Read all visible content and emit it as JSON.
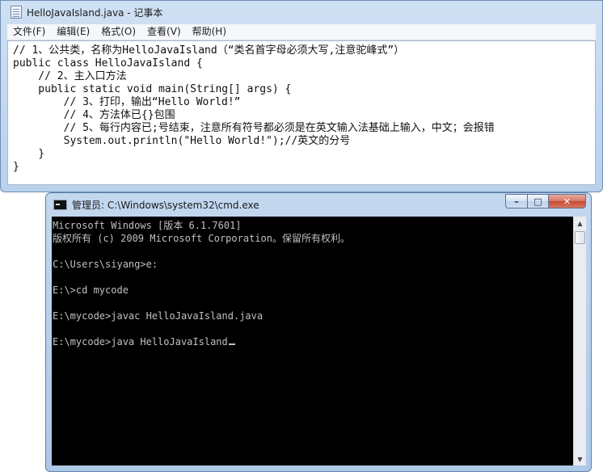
{
  "notepad": {
    "title": "HelloJavaIsland.java - 记事本",
    "menu": [
      {
        "label": "文件(F)"
      },
      {
        "label": "编辑(E)"
      },
      {
        "label": "格式(O)"
      },
      {
        "label": "查看(V)"
      },
      {
        "label": "帮助(H)"
      }
    ],
    "lines": [
      "// 1、公共类，名称为HelloJavaIsland（“类名首字母必须大写,注意驼峰式”）",
      "public class HelloJavaIsland {",
      "    // 2、主入口方法",
      "    public static void main(String[] args) {",
      "        // 3、打印，输出“Hello World!”",
      "        // 4、方法体已{}包围",
      "        // 5、每行内容已;号结束，注意所有符号都必须是在英文输入法基础上输入，中文；会报错",
      "        System.out.println(\"Hello World!\");//英文的分号",
      "    }",
      "}"
    ]
  },
  "cmd": {
    "title": "管理员: C:\\Windows\\system32\\cmd.exe",
    "buttons": {
      "minimize": "–",
      "maximize": "□",
      "close": "✕"
    },
    "lines": [
      "Microsoft Windows [版本 6.1.7601]",
      "版权所有 (c) 2009 Microsoft Corporation。保留所有权利。",
      "",
      "C:\\Users\\siyang>e:",
      "",
      "E:\\>cd mycode",
      "",
      "E:\\mycode>javac HelloJavaIsland.java",
      "",
      "E:\\mycode>java HelloJavaIsland"
    ],
    "scroll": {
      "up": "▲",
      "down": "▼"
    }
  }
}
